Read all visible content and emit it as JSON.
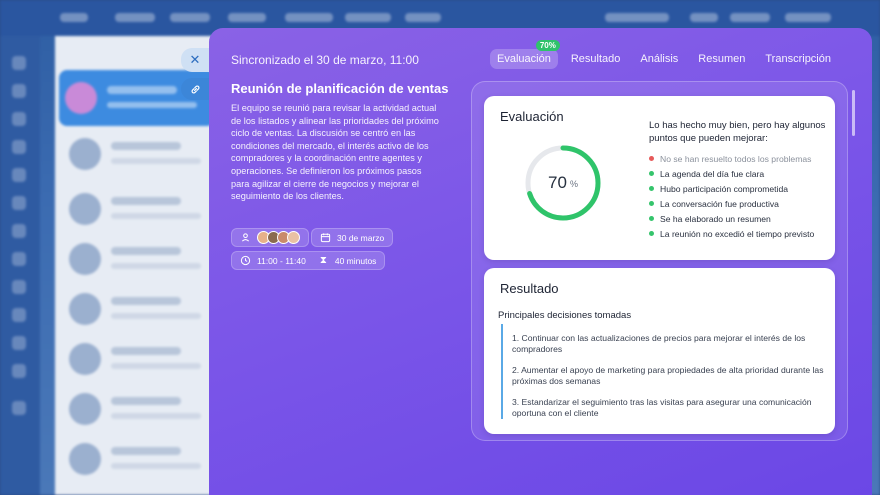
{
  "panel": {
    "sync_status": "Sincronizado el 30 de marzo, 11:00",
    "tabs": [
      {
        "label": "Evaluación",
        "badge": "70%",
        "active": true
      },
      {
        "label": "Resultado"
      },
      {
        "label": "Análisis"
      },
      {
        "label": "Resumen"
      },
      {
        "label": "Transcripción"
      }
    ]
  },
  "meeting": {
    "title": "Reunión de planificación de ventas",
    "description": "El equipo se reunió para revisar la actividad actual de los listados y alinear las prioridades del próximo ciclo de ventas. La discusión se centró en las condiciones del mercado, el interés activo de los compradores y la coordinación entre agentes y operaciones. Se definieron los próximos pasos para agilizar el cierre de negocios y mejorar el seguimiento de los clientes.",
    "date": "30 de marzo",
    "time": "11:00 - 11:40",
    "duration": "40 minutos",
    "participant_colors": [
      "#e7b18a",
      "#8a6a4f",
      "#c98a6b",
      "#e9c1a4"
    ]
  },
  "evaluation": {
    "heading": "Evaluación",
    "score": 70,
    "score_unit": "%",
    "intro": "Lo has hecho muy bien, pero hay algunos puntos que pueden mejorar:",
    "items": [
      {
        "text": "No se han resuelto todos los problemas",
        "status": "bad"
      },
      {
        "text": "La agenda del día fue clara",
        "status": "good"
      },
      {
        "text": "Hubo participación comprometida",
        "status": "good"
      },
      {
        "text": "La conversación fue productiva",
        "status": "good"
      },
      {
        "text": "Se ha elaborado un resumen",
        "status": "good"
      },
      {
        "text": "La reunión no excedió el tiempo previsto",
        "status": "good"
      }
    ]
  },
  "result": {
    "heading": "Resultado",
    "subheading": "Principales decisiones tomadas",
    "decisions": [
      "1. Continuar con las actualizaciones de precios para mejorar el interés de los compradores",
      "2. Aumentar el apoyo de marketing para propiedades de alta prioridad durante las próximas dos semanas",
      "3. Estandarizar el seguimiento tras las visitas para asegurar una comunicación oportuna con el cliente"
    ]
  },
  "colors": {
    "accent_green": "#35c46c",
    "accent_red": "#e65a5a",
    "panel_purple": "#7b56e8"
  }
}
